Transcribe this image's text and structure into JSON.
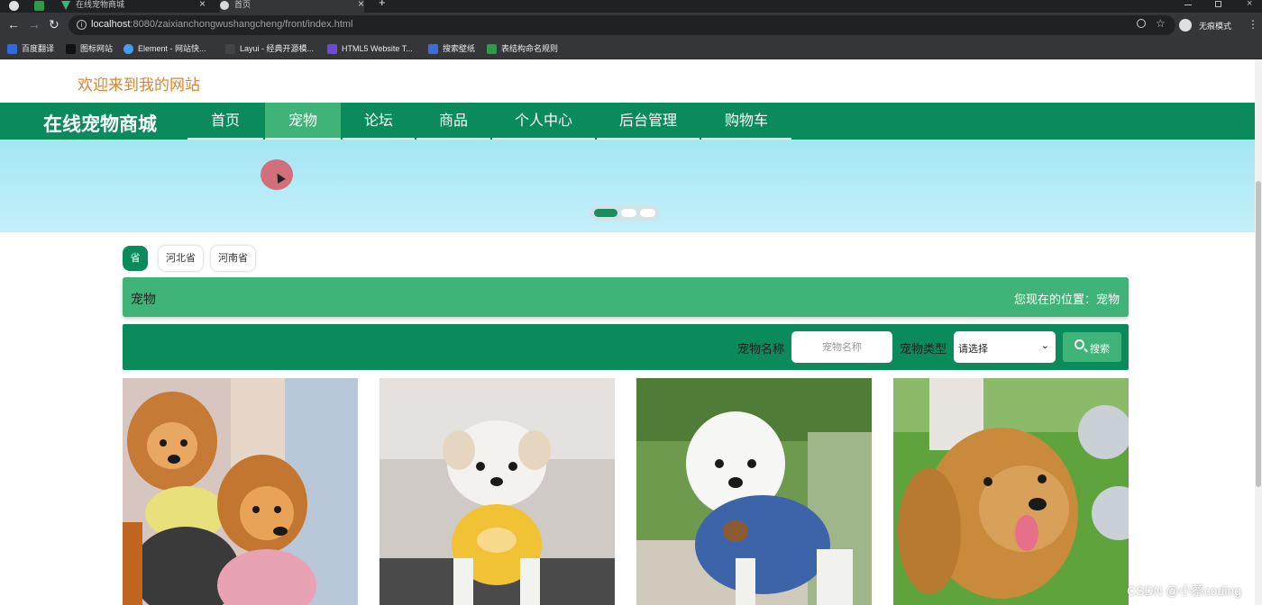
{
  "browser": {
    "tabs": [
      {
        "label": "在线宠物商城"
      },
      {
        "label": "首页"
      }
    ],
    "url_host": "localhost",
    "url_rest": ":8080/zaixianchongwushangcheng/front/index.html",
    "profile_label": "无痕模式",
    "bookmarks": [
      {
        "label": "百度翻译",
        "color": "#2f6bdc"
      },
      {
        "label": "图标网站",
        "color": "#111111"
      },
      {
        "label": "Element - 网站快...",
        "color": "#409eff"
      },
      {
        "label": "Layui - 经典开源模...",
        "color": "#444444"
      },
      {
        "label": "HTML5 Website T...",
        "color": "#6d4adc"
      },
      {
        "label": "搜索壁纸",
        "color": "#3a6fd8"
      },
      {
        "label": "表结构命名规则",
        "color": "#2e9a4a"
      }
    ]
  },
  "header": {
    "welcome": "欢迎来到我的网站",
    "site_title": "在线宠物商城"
  },
  "nav": {
    "items": [
      "首页",
      "宠物",
      "论坛",
      "商品",
      "个人中心",
      "后台管理",
      "购物车"
    ],
    "active": "宠物"
  },
  "banner": {
    "slide_count": 3,
    "active_slide": 1
  },
  "filters": {
    "province_all": "省",
    "provinces": [
      "河北省",
      "河南省"
    ]
  },
  "breadcrumb": {
    "title": "宠物",
    "location": "您现在的位置：宠物"
  },
  "search": {
    "name_label": "宠物名称",
    "name_placeholder": "宠物名称",
    "type_label": "宠物类型",
    "type_value": "请选择",
    "button_label": "搜索"
  },
  "products": [
    {
      "image": "pomeranian-dogs-photo"
    },
    {
      "image": "white-puppy-photo"
    },
    {
      "image": "poodle-in-shirt-photo"
    },
    {
      "image": "golden-retriever-photo"
    }
  ],
  "colors": {
    "primary": "#0b8a5c",
    "accent": "#3fb378",
    "welcome": "#e0822e"
  },
  "watermark": "CSDN @小蔡coding"
}
